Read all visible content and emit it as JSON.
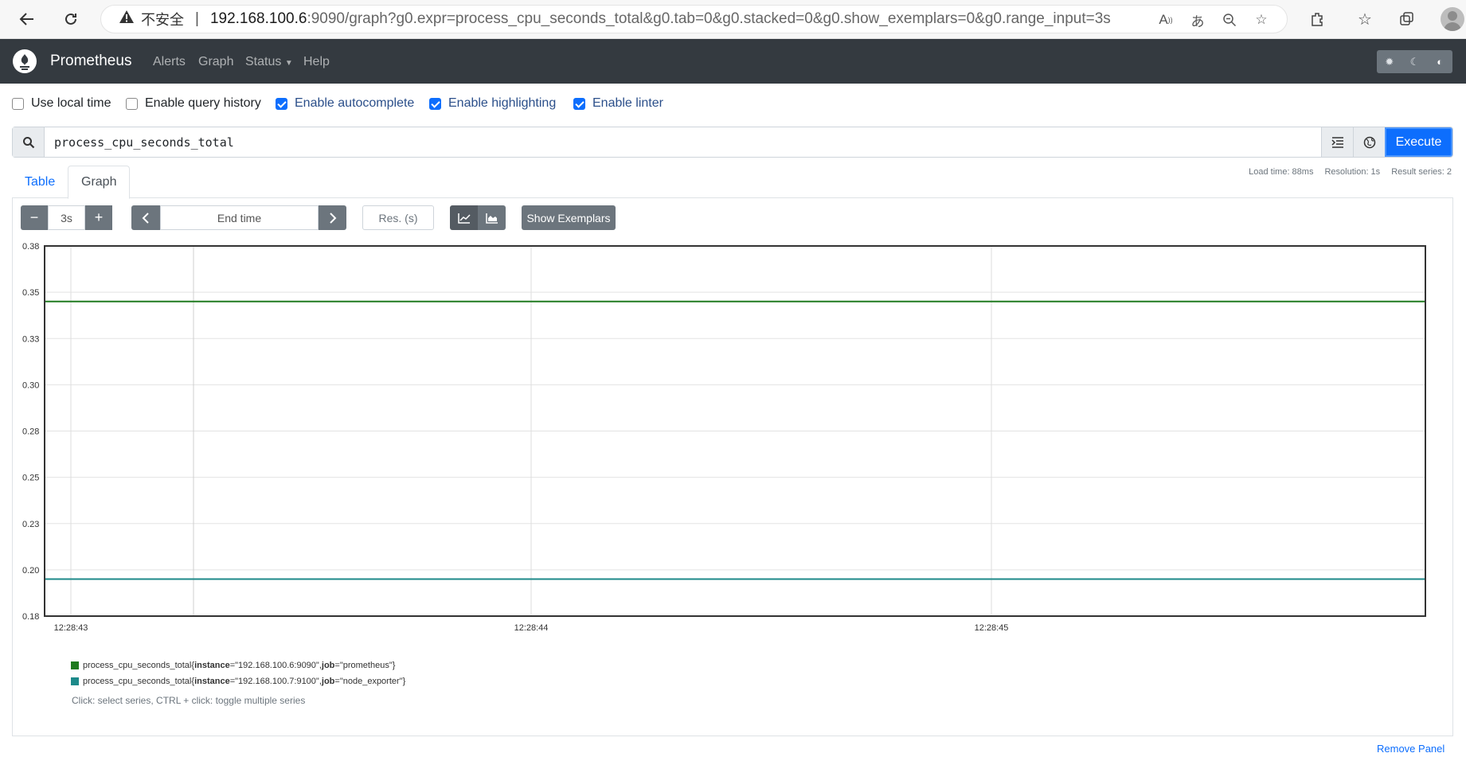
{
  "browser": {
    "warning_text": "不安全",
    "url_host": "192.168.100.6",
    "url_rest": ":9090/graph?g0.expr=process_cpu_seconds_total&g0.tab=0&g0.stacked=0&g0.show_exemplars=0&g0.range_input=3s"
  },
  "navbar": {
    "brand": "Prometheus",
    "links": [
      "Alerts",
      "Graph",
      "Status",
      "Help"
    ]
  },
  "options": [
    {
      "label": "Use local time",
      "checked": false
    },
    {
      "label": "Enable query history",
      "checked": false
    },
    {
      "label": "Enable autocomplete",
      "checked": true
    },
    {
      "label": "Enable highlighting",
      "checked": true
    },
    {
      "label": "Enable linter",
      "checked": true
    }
  ],
  "query": {
    "expression": "process_cpu_seconds_total",
    "execute_label": "Execute"
  },
  "tabs": [
    "Table",
    "Graph"
  ],
  "stats": {
    "load_time": "Load time: 88ms",
    "resolution": "Resolution: 1s",
    "result_series": "Result series: 2"
  },
  "controls": {
    "range": "3s",
    "end_time_placeholder": "End time",
    "res_placeholder": "Res. (s)",
    "exemplars_label": "Show Exemplars",
    "minus": "−",
    "plus": "+"
  },
  "chart_data": {
    "type": "line",
    "y_ticks": [
      "0.38",
      "0.35",
      "0.33",
      "0.30",
      "0.28",
      "0.25",
      "0.23",
      "0.20",
      "0.18"
    ],
    "x_ticks": [
      "12:28:43",
      "12:28:44",
      "12:28:45"
    ],
    "ylim": [
      0.18,
      0.38
    ],
    "series": [
      {
        "name": "process_cpu_seconds_total{instance=\"192.168.100.6:9090\", job=\"prometheus\"}",
        "instance": "192.168.100.6:9090",
        "job": "prometheus",
        "color": "#1f7a1f",
        "values": [
          0.35,
          0.35,
          0.35,
          0.35
        ]
      },
      {
        "name": "process_cpu_seconds_total{instance=\"192.168.100.7:9100\", job=\"node_exporter\"}",
        "instance": "192.168.100.7:9100",
        "job": "node_exporter",
        "color": "#1d8a8a",
        "values": [
          0.2,
          0.2,
          0.2,
          0.2
        ]
      }
    ]
  },
  "legend": {
    "metric": "process_cpu_seconds_total",
    "hint": "Click: select series, CTRL + click: toggle multiple series"
  },
  "remove_panel": "Remove Panel"
}
